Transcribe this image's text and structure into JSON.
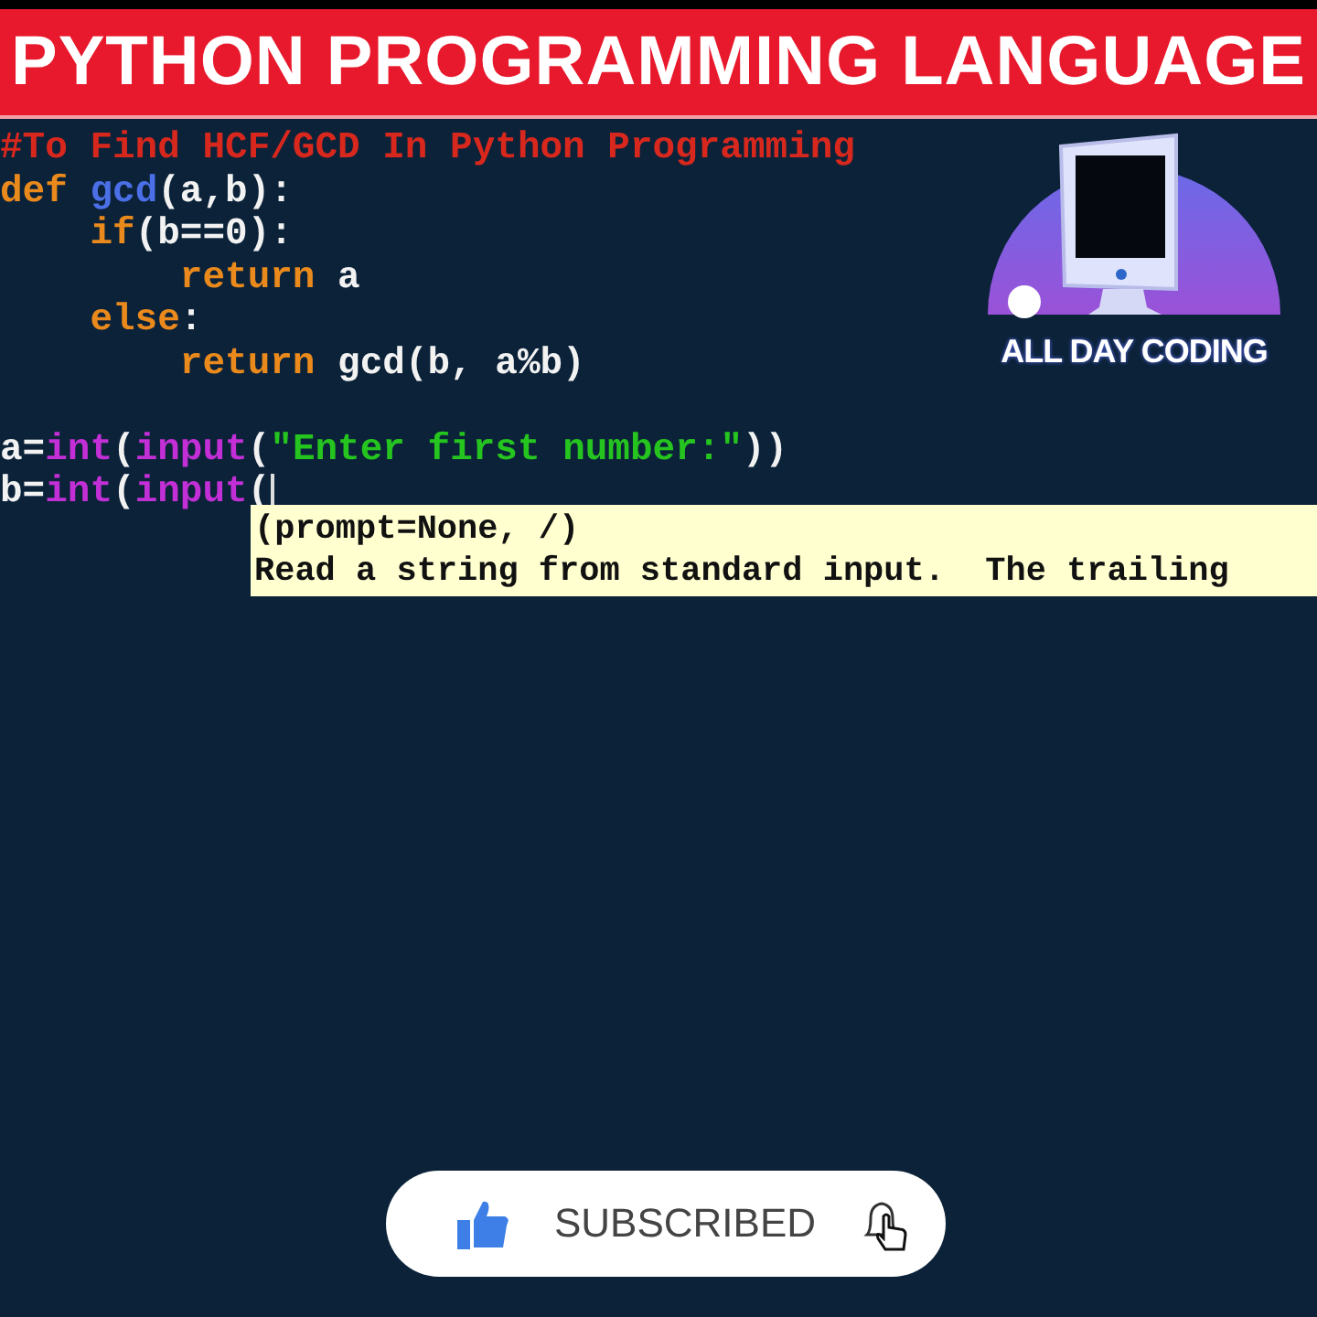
{
  "banner": {
    "title": "PYTHON PROGRAMMING LANGUAGE"
  },
  "editor": {
    "lines": [
      {
        "kind": "code",
        "tokens": [
          {
            "kind": "comment",
            "text": "#To Find HCF/GCD In Python Programming"
          }
        ]
      },
      {
        "kind": "code",
        "tokens": [
          {
            "kind": "keyword",
            "text": "def "
          },
          {
            "kind": "defname",
            "text": "gcd"
          },
          {
            "kind": "plain",
            "text": "(a,b):"
          }
        ]
      },
      {
        "kind": "code",
        "tokens": [
          {
            "kind": "keyword",
            "text": "    if"
          },
          {
            "kind": "plain",
            "text": "(b==0):"
          }
        ]
      },
      {
        "kind": "code",
        "tokens": [
          {
            "kind": "keyword",
            "text": "        return"
          },
          {
            "kind": "plain",
            "text": " a"
          }
        ]
      },
      {
        "kind": "code",
        "tokens": [
          {
            "kind": "keyword",
            "text": "    else"
          },
          {
            "kind": "plain",
            "text": ":"
          }
        ]
      },
      {
        "kind": "code",
        "tokens": [
          {
            "kind": "keyword",
            "text": "        return"
          },
          {
            "kind": "plain",
            "text": " gcd(b, a%b)"
          }
        ]
      },
      {
        "kind": "blank"
      },
      {
        "kind": "code",
        "tokens": [
          {
            "kind": "plain",
            "text": "a="
          },
          {
            "kind": "builtin",
            "text": "int"
          },
          {
            "kind": "plain",
            "text": "("
          },
          {
            "kind": "builtin",
            "text": "input"
          },
          {
            "kind": "plain",
            "text": "("
          },
          {
            "kind": "string",
            "text": "\"Enter first number:\""
          },
          {
            "kind": "plain",
            "text": "))"
          }
        ]
      },
      {
        "kind": "code",
        "tokens": [
          {
            "kind": "plain",
            "text": "b="
          },
          {
            "kind": "builtin",
            "text": "int"
          },
          {
            "kind": "plain",
            "text": "("
          },
          {
            "kind": "builtin",
            "text": "input"
          },
          {
            "kind": "plain",
            "text": "("
          },
          {
            "kind": "caret"
          }
        ]
      }
    ]
  },
  "tooltip": {
    "signature": "(prompt=None, /)",
    "doc": "Read a string from standard input.  The trailing"
  },
  "logo": {
    "name": "ALL DAY CODING"
  },
  "subscribe": {
    "label": "SUBSCRIBED"
  }
}
